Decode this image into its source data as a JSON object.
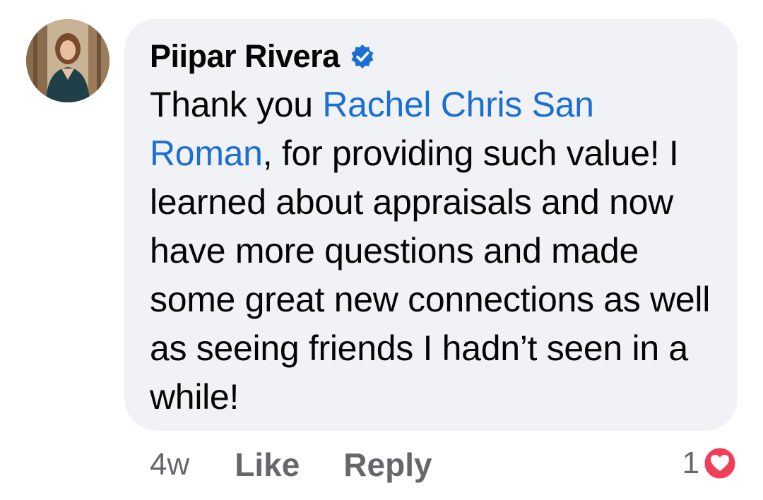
{
  "comment": {
    "author": "Piipar Rivera",
    "verified": true,
    "text_before_mention": "Thank you ",
    "mention": "Rachel Chris San Roman",
    "text_after_mention": ", for providing such value! I learned about appraisals and now have more questions and made some great new connections as well as seeing friends I hadn’t seen in a while!",
    "timestamp": "4w",
    "like_label": "Like",
    "reply_label": "Reply",
    "reaction_count": "1",
    "reaction_icon": "heart-icon"
  },
  "colors": {
    "mention": "#1b6ed3",
    "verified_badge": "#1b6ed3",
    "bubble_background": "#f0f2f5",
    "secondary_text": "#65676b",
    "heart_reaction": "#f33e58"
  }
}
